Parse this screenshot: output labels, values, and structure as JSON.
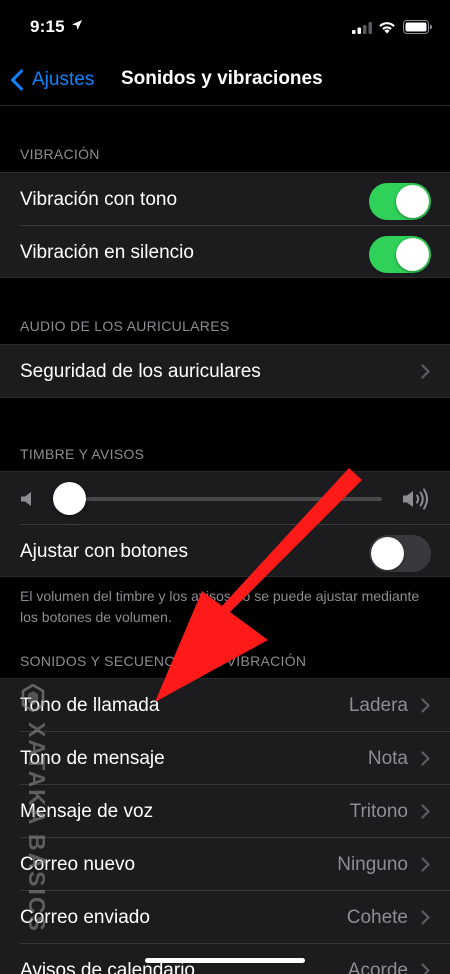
{
  "status_bar": {
    "time": "9:15"
  },
  "nav": {
    "back_label": "Ajustes",
    "title": "Sonidos y vibraciones"
  },
  "sections": {
    "vibration": {
      "header": "VIBRACIÓN",
      "rows": [
        {
          "label": "Vibración con tono",
          "on": true
        },
        {
          "label": "Vibración en silencio",
          "on": true
        }
      ]
    },
    "headphones": {
      "header": "AUDIO DE LOS AURICULARES",
      "rows": [
        {
          "label": "Seguridad de los auriculares"
        }
      ]
    },
    "ringer": {
      "header": "TIMBRE Y AVISOS",
      "volume_level": 0.0,
      "adjust_label": "Ajustar con botones",
      "adjust_on": false,
      "footnote": "El volumen del timbre y los avisos no se puede ajustar mediante los botones de volumen."
    },
    "sounds": {
      "header": "SONIDOS Y SECUENCIAS DE VIBRACIÓN",
      "rows": [
        {
          "label": "Tono de llamada",
          "value": "Ladera"
        },
        {
          "label": "Tono de mensaje",
          "value": "Nota"
        },
        {
          "label": "Mensaje de voz",
          "value": "Tritono"
        },
        {
          "label": "Correo nuevo",
          "value": "Ninguno"
        },
        {
          "label": "Correo enviado",
          "value": "Cohete"
        },
        {
          "label": "Avisos de calendario",
          "value": "Acorde"
        }
      ]
    }
  },
  "watermark": {
    "text": "XATAKA BASICS"
  },
  "colors": {
    "accent": "#0a84ff",
    "toggle_on": "#30d158",
    "arrow": "#ff1a1a"
  }
}
